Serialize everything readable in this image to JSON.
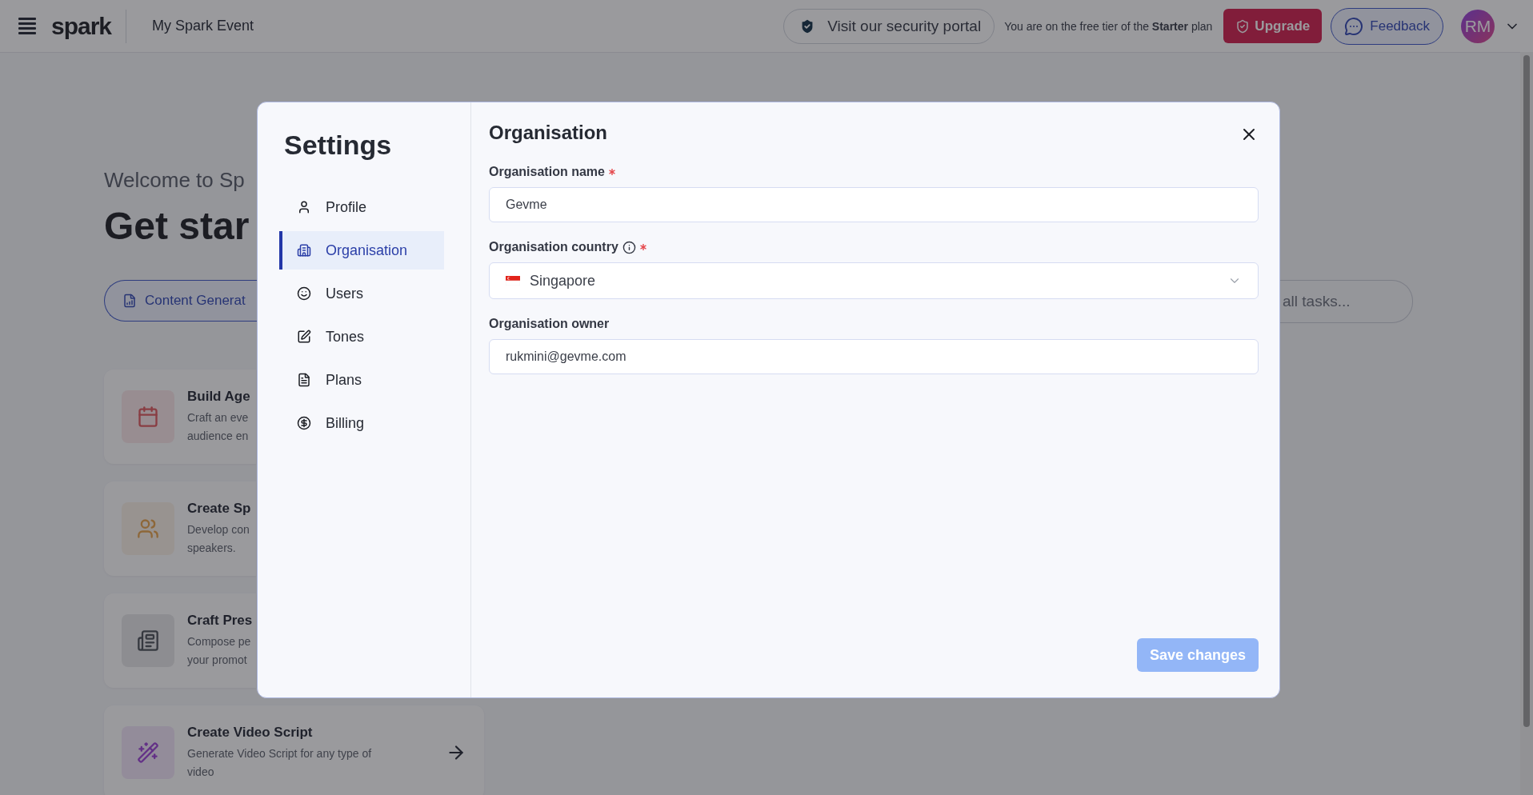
{
  "top_bar": {
    "logo": "spark",
    "event_title": "My Spark Event",
    "security_link": "Visit our security portal",
    "plan_notice": "You are on the free tier of the **Starter** plan",
    "upgrade_button": "Upgrade",
    "feedback_button": "Feedback",
    "avatar_initials": "RM"
  },
  "page": {
    "welcome": "Welcome to Sp",
    "heading": "Get star",
    "filter_pill": "Content Generat",
    "search_pill": "all tasks...",
    "cards": [
      {
        "title": "Build Age",
        "description_lines": [
          "Craft an eve",
          "audience en"
        ]
      },
      {
        "title": "Create Sp",
        "description_lines": [
          "Develop con",
          "speakers."
        ]
      },
      {
        "title": "Craft Pres",
        "description_lines": [
          "Compose pe",
          "your promot"
        ]
      },
      {
        "title": "Create Video Script",
        "description_lines": [
          "Generate Video Script for any type of",
          "video"
        ],
        "arrow": true
      }
    ]
  },
  "settings_dialog": {
    "title": "Settings",
    "menu": [
      {
        "label": "Profile",
        "selected": false
      },
      {
        "label": "Organisation",
        "selected": true
      },
      {
        "label": "Users",
        "selected": false
      },
      {
        "label": "Tones",
        "selected": false
      },
      {
        "label": "Plans",
        "selected": false
      },
      {
        "label": "Billing",
        "selected": false
      }
    ],
    "section_title": "Organisation",
    "fields": [
      {
        "kind": "text",
        "label": "Organisation name",
        "required": true,
        "info": false,
        "value": "Gevme"
      },
      {
        "kind": "select",
        "label": "Organisation country",
        "required": true,
        "info": true,
        "value": "Singapore"
      },
      {
        "kind": "text",
        "label": "Organisation owner",
        "required": false,
        "info": false,
        "value": "rukmini@gevme.com"
      }
    ],
    "save_button": {
      "label": "Save changes",
      "disabled": true
    }
  }
}
